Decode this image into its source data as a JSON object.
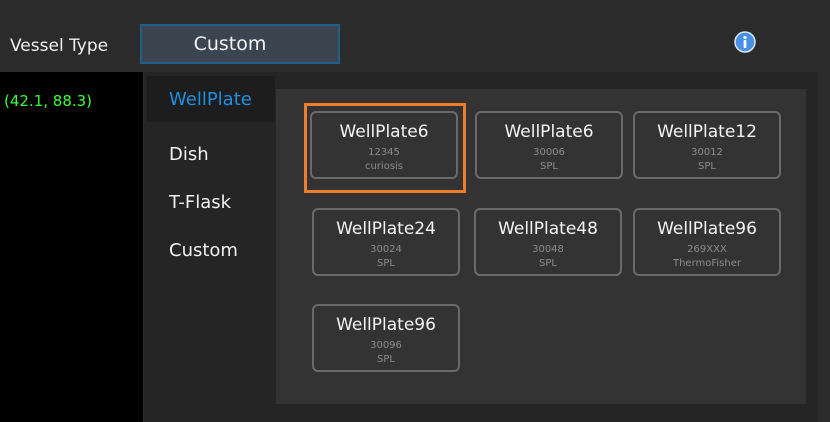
{
  "header": {
    "vessel_type_label": "Vessel Type",
    "vessel_type_value": "Custom",
    "info_icon": "info-icon"
  },
  "status": {
    "coordinates": "(42.1, 88.3)"
  },
  "categories": [
    {
      "label": "WellPlate",
      "selected": true
    },
    {
      "label": "Dish",
      "selected": false
    },
    {
      "label": "T-Flask",
      "selected": false
    },
    {
      "label": "Custom",
      "selected": false
    }
  ],
  "vessels": [
    {
      "name": "WellPlate6",
      "code": "12345",
      "brand": "curiosis",
      "selected": true
    },
    {
      "name": "WellPlate6",
      "code": "30006",
      "brand": "SPL",
      "selected": false
    },
    {
      "name": "WellPlate12",
      "code": "30012",
      "brand": "SPL",
      "selected": false
    },
    {
      "name": "WellPlate24",
      "code": "30024",
      "brand": "SPL",
      "selected": false
    },
    {
      "name": "WellPlate48",
      "code": "30048",
      "brand": "SPL",
      "selected": false
    },
    {
      "name": "WellPlate96",
      "code": "269XXX",
      "brand": "ThermoFisher",
      "selected": false
    },
    {
      "name": "WellPlate96",
      "code": "30096",
      "brand": "SPL",
      "selected": false
    }
  ],
  "colors": {
    "accent_blue": "#1f8fe0",
    "selection_orange": "#ee7d2d",
    "coord_green": "#38ff38"
  }
}
